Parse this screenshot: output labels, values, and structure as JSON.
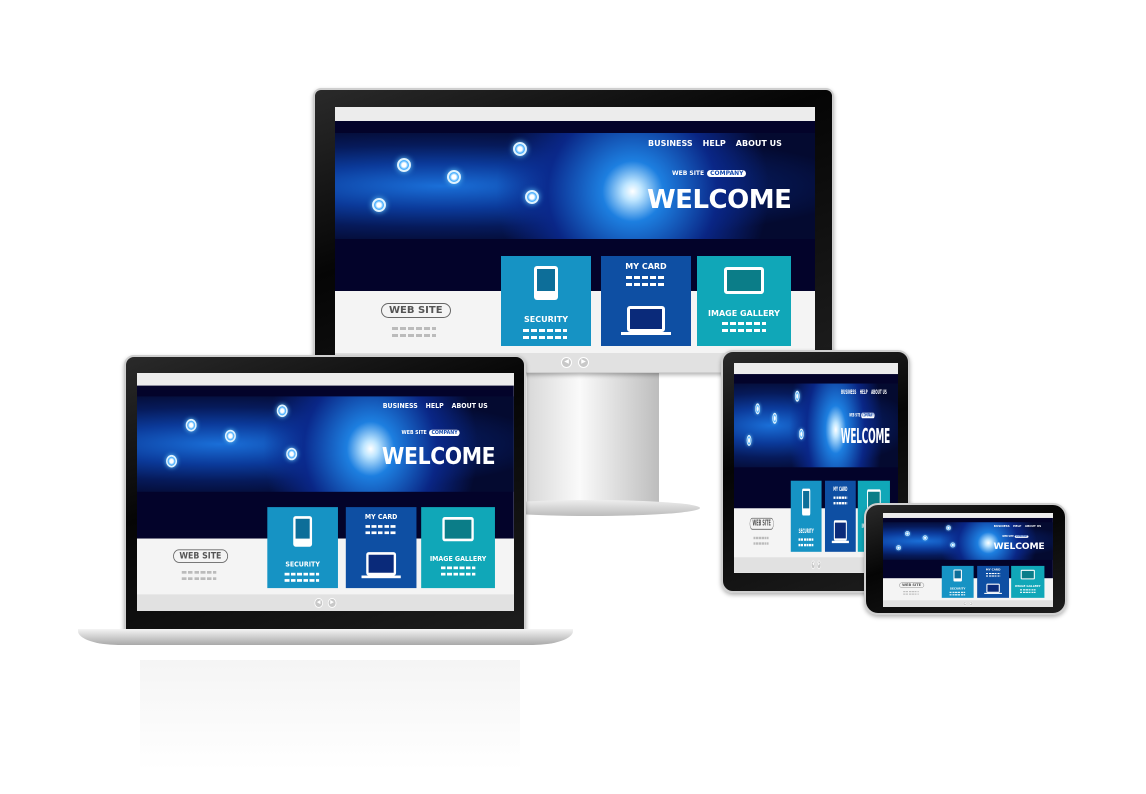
{
  "site": {
    "nav": [
      "BUSINESS",
      "HELP",
      "ABOUT US"
    ],
    "tagline": "WEB SITE",
    "tagline_pill": "COMPANY",
    "headline": "WELCOME",
    "logo_pill": "WEB SITE",
    "cards": [
      {
        "label": "SECURITY",
        "icon": "phone-icon",
        "color": "#1693c4"
      },
      {
        "label": "MY CARD",
        "icon": "laptop-icon",
        "color": "#0e4fa3"
      },
      {
        "label": "IMAGE GALLERY",
        "icon": "monitor-icon",
        "color": "#10a7b8"
      }
    ],
    "prev_icon": "chevron-left-icon",
    "next_icon": "chevron-right-icon"
  },
  "devices": [
    "monitor",
    "laptop",
    "tablet",
    "phone"
  ]
}
